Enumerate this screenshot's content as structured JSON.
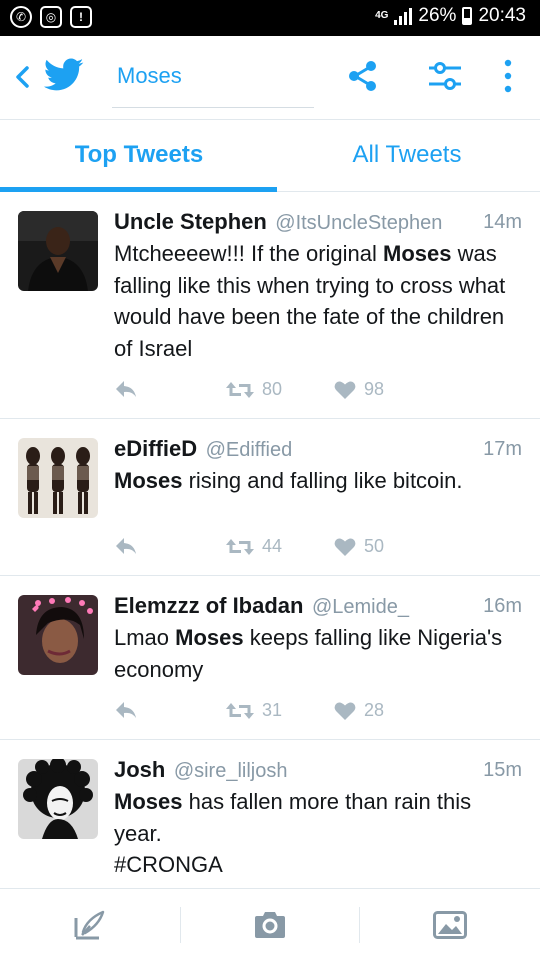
{
  "status_bar": {
    "network": "4G",
    "battery": "26%",
    "time": "20:43"
  },
  "header": {
    "search_text": "Moses"
  },
  "tabs": [
    {
      "label": "Top Tweets"
    },
    {
      "label": "All Tweets"
    }
  ],
  "tweets": [
    {
      "name": "Uncle Stephen",
      "handle": "@ItsUncleStephen",
      "time": "14m",
      "text_parts": [
        "Mtcheeeew!!! If the original ",
        "Moses",
        " was falling like this when trying to cross what would have been the fate of the children of Israel"
      ],
      "retweets": "80",
      "likes": "98"
    },
    {
      "name": "eDiffieD",
      "handle": "@Ediffied",
      "time": "17m",
      "text_parts": [
        "Moses",
        " rising and falling like bitcoin."
      ],
      "retweets": "44",
      "likes": "50"
    },
    {
      "name": "Elemzzz of Ibadan",
      "handle": "@Lemide_",
      "time": "16m",
      "text_parts": [
        "Lmao ",
        "Moses",
        " keeps falling like Nigeria's economy"
      ],
      "retweets": "31",
      "likes": "28"
    },
    {
      "name": "Josh",
      "handle": "@sire_liljosh",
      "time": "15m",
      "text_parts": [
        "Moses",
        " has fallen more than rain this year."
      ],
      "hashtag": "#CRONGA"
    }
  ],
  "icons": {
    "header": [
      "back-icon",
      "twitter-bird-icon",
      "share-icon",
      "filter-icon",
      "more-icon"
    ],
    "bottom_bar": [
      "compose-icon",
      "camera-icon",
      "image-icon"
    ]
  },
  "colors": {
    "accent": "#1da1f2",
    "muted": "#8899a6",
    "action_gray": "#aab8c2"
  }
}
